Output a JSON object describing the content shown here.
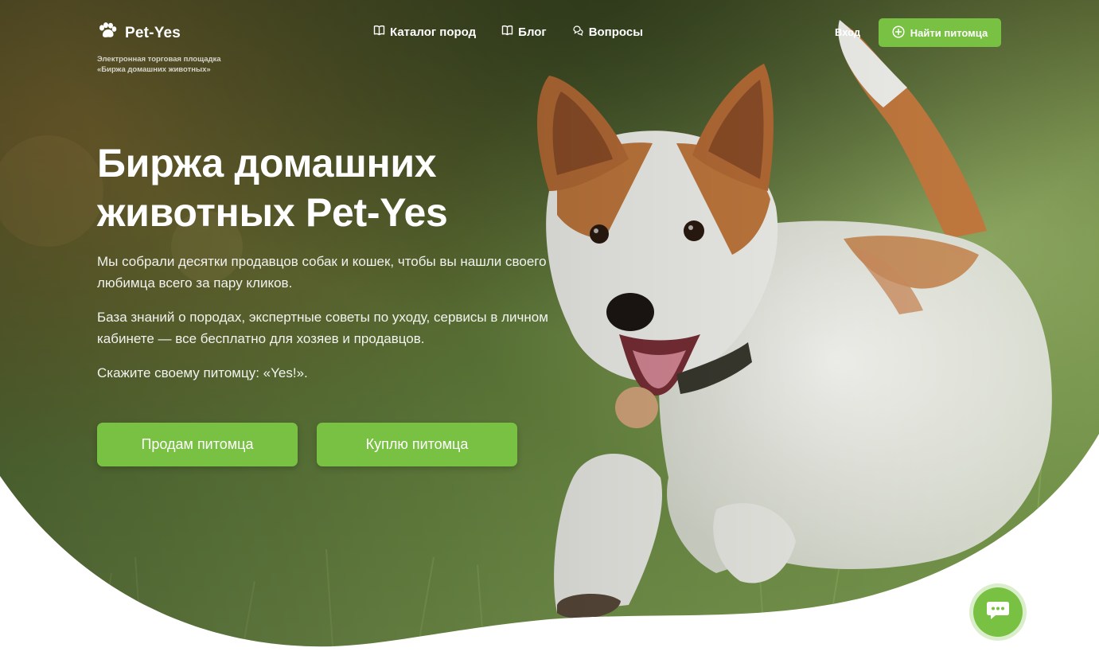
{
  "brand": {
    "name": "Pet-Yes",
    "tagline_line1": "Электронная торговая площадка",
    "tagline_line2": "«Биржа домашних животных»",
    "logo_icon": "paw-icon",
    "accent_color": "#79c143"
  },
  "nav": {
    "items": [
      {
        "label": "Каталог пород",
        "icon": "book-icon"
      },
      {
        "label": "Блог",
        "icon": "book-icon"
      },
      {
        "label": "Вопросы",
        "icon": "chat-bubbles-icon"
      }
    ],
    "login_label": "Вход",
    "find_pet_label": "Найти питомца",
    "find_pet_icon": "plus-circle-icon"
  },
  "hero": {
    "title_line1": "Биржа домашних",
    "title_line2": "животных Pet-Yes",
    "paragraph1": "Мы собрали десятки продавцов собак и кошек, чтобы вы нашли своего любимца всего за пару кликов.",
    "paragraph2": "База знаний о породах, экспертные советы по уходу, сервисы в личном кабинете — все бесплатно для хозяев и продавцов.",
    "paragraph3": "Скажите своему питомцу: «Yes!».",
    "sell_button": "Продам питомца",
    "buy_button": "Куплю питомца"
  },
  "chat": {
    "icon": "chat-dots-icon"
  }
}
